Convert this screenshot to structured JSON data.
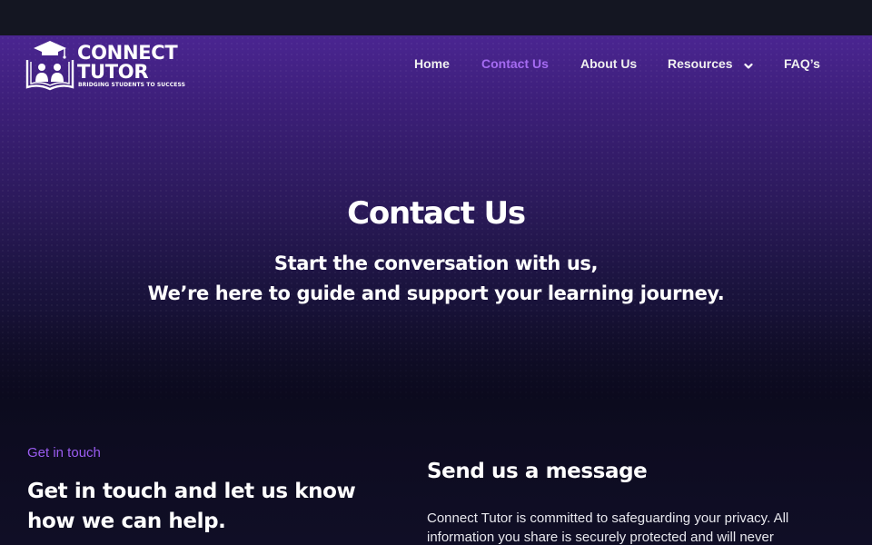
{
  "logo": {
    "name": "CONNECT\nTUTOR",
    "tagline": "BRIDGING STUDENTS TO SUCCESS"
  },
  "nav": {
    "items": [
      {
        "label": "Home"
      },
      {
        "label": "Contact Us",
        "active": true
      },
      {
        "label": "About Us"
      },
      {
        "label": "Resources",
        "has_dropdown": true
      },
      {
        "label": "FAQ’s"
      }
    ]
  },
  "hero": {
    "title": "Contact Us",
    "subtitle_line1": "Start the conversation with us,",
    "subtitle_line2": "We’re here to guide and support your learning journey."
  },
  "contact": {
    "eyebrow": "Get in touch",
    "heading": "Get in touch and let us know how we can help.",
    "form_heading": "Send us a message",
    "privacy_text": "Connect Tutor is committed to safeguarding your privacy. All information you share is securely protected and will never"
  },
  "colors": {
    "accent": "#a56bf2",
    "hero_top": "#4a2591",
    "background": "#0d0c1f",
    "topbar": "#141622"
  }
}
